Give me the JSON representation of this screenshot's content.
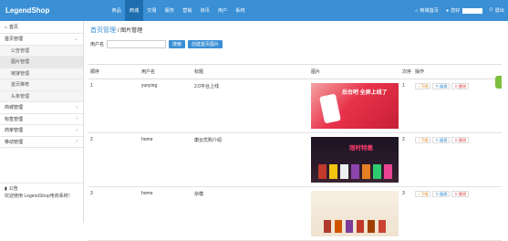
{
  "header": {
    "brand": "LegendShop",
    "nav": [
      "商品",
      "商城",
      "交易",
      "服务",
      "营销",
      "资讯",
      "用户",
      "系统"
    ],
    "active_nav": 1,
    "home_link": "商城首页",
    "user_label": "您好",
    "logout_label": "退出"
  },
  "sidebar": {
    "home": "首页",
    "groups": [
      {
        "label": "首页管理",
        "expanded": true,
        "items": [
          "公告管理",
          "图片管理",
          "链接管理",
          "首页推荐",
          "头条管理"
        ],
        "active_item": 1
      },
      {
        "label": "商城管理"
      },
      {
        "label": "标签管理"
      },
      {
        "label": "商家管理"
      },
      {
        "label": "移动管理"
      }
    ],
    "notice": {
      "title": "公告",
      "text": "欢迎使用 LegendShop电商系统！"
    }
  },
  "main": {
    "breadcrumb": {
      "section": "首页管理",
      "page": "图片管理"
    },
    "search": {
      "label": "用户名",
      "value": "",
      "search_button": "搜索",
      "create_button": "创建首页图片"
    },
    "table": {
      "columns": [
        "顺序",
        "用户名",
        "标题",
        "图片",
        "次序",
        "操作"
      ],
      "rows": [
        {
          "order": "1",
          "user": "yunying",
          "title": "2.0平台上线",
          "seq": "1",
          "image": "phone-promo",
          "image_text": "后台吧 全屏上线了"
        },
        {
          "order": "2",
          "user": "home",
          "title": "康云优购介绍",
          "seq": "2",
          "image": "products-dark",
          "image_text": "限时特惠"
        },
        {
          "order": "3",
          "user": "home",
          "title": "杂模",
          "seq": "3",
          "image": "products-light",
          "image_text": ""
        }
      ],
      "actions": {
        "down": "下线",
        "edit": "编辑",
        "delete": "删除"
      }
    }
  },
  "colors": {
    "accent": "#3a8fd5",
    "nav_active": "#1f6fb0",
    "danger": "#e23d3d",
    "warn": "#e07b00"
  }
}
